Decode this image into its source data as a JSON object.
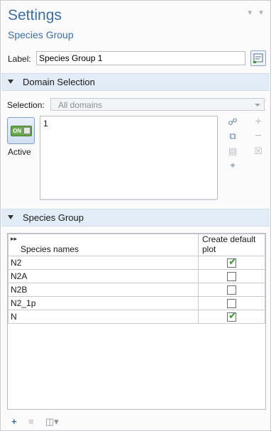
{
  "header": {
    "title": "Settings",
    "subtitle": "Species Group"
  },
  "label_field": {
    "label": "Label:",
    "value": "Species Group 1"
  },
  "domain_selection": {
    "section_title": "Domain Selection",
    "selection_label": "Selection:",
    "selection_value": "All domains",
    "active_toggle_text": "ON",
    "active_label": "Active",
    "items": [
      "1"
    ]
  },
  "species_group": {
    "section_title": "Species Group",
    "columns": [
      "Species names",
      "Create default plot"
    ],
    "rows": [
      {
        "name": "N2",
        "create_default_plot": true
      },
      {
        "name": "N2A",
        "create_default_plot": false
      },
      {
        "name": "N2B",
        "create_default_plot": false
      },
      {
        "name": "N2_1p",
        "create_default_plot": false
      },
      {
        "name": "N",
        "create_default_plot": true
      }
    ]
  },
  "icons": {
    "pin": "pin-icon",
    "close": "close-icon",
    "label_button": "edit-label-icon",
    "tools": [
      "select-icon",
      "copy-icon",
      "paste-icon",
      "zoom-to-selection-icon",
      "add-icon",
      "remove-icon",
      "clear-icon"
    ],
    "bottom": [
      "add-row-icon",
      "delete-row-icon",
      "table-options-icon"
    ]
  },
  "colors": {
    "accent": "#3a6ea5",
    "section_bg": "#e2ecf6",
    "check": "#3c9a2e",
    "toggle_on": "#6aa84f"
  }
}
